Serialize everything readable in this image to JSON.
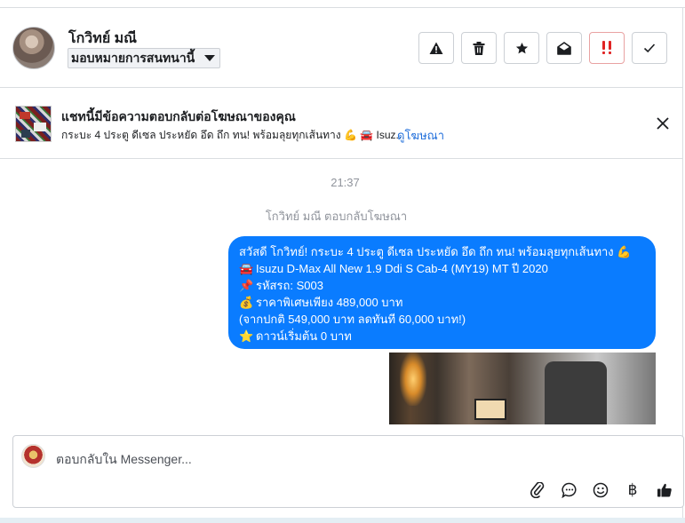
{
  "header": {
    "contact_name": "โกวิทย์ มณี",
    "assign_label": "มอบหมายการสนทนานี้",
    "actions": [
      {
        "name": "report-spam-button",
        "icon": "warning-icon"
      },
      {
        "name": "delete-button",
        "icon": "trash-icon"
      },
      {
        "name": "star-button",
        "icon": "star-icon"
      },
      {
        "name": "mark-unread-button",
        "icon": "envelope-open-icon"
      },
      {
        "name": "follow-up-button",
        "icon": "exclamation-icon"
      },
      {
        "name": "mark-done-button",
        "icon": "check-icon"
      }
    ]
  },
  "banner": {
    "title": "แชทนี้มีข้อความตอบกลับต่อโฆษณาของคุณ",
    "subtitle": "กระบะ 4 ประตู ดีเซล ประหยัด อึด ถึก ทน! พร้อมลุยทุกเส้นทาง 💪 🚘 Isuz...",
    "link": "ดูโฆษณา"
  },
  "thread": {
    "time": "21:37",
    "note": "โกวิทย์ มณี ตอบกลับโฆษณา",
    "message_lines": [
      {
        "emoji": "",
        "text": "สวัสดี โกวิทย์! กระบะ 4 ประตู ดีเซล ประหยัด อึด ถึก ทน! พร้อมลุยทุกเส้นทาง 💪"
      },
      {
        "emoji": "🚘",
        "text": "Isuzu D-Max All New 1.9 Ddi S Cab-4 (MY19) MT ปี 2020"
      },
      {
        "emoji": "📌",
        "text": "รหัสรถ: S003"
      },
      {
        "emoji": "💰",
        "text": "ราคาพิเศษเพียง 489,000 บาท"
      },
      {
        "emoji": "",
        "text": "(จากปกติ 549,000 บาท ลดทันที 60,000 บาท!)"
      },
      {
        "emoji": "⭐",
        "text": "ดาวน์เริ่มต้น 0 บาท"
      }
    ]
  },
  "composer": {
    "placeholder": "ตอบกลับใน Messenger...",
    "tools": [
      "paperclip-icon",
      "chat-bubble-icon",
      "emoji-icon",
      "baht-icon",
      "thumbs-up-icon"
    ],
    "baht_symbol": "฿"
  },
  "colors": {
    "bubble": "#0a7cff",
    "link": "#216fdb",
    "follow_up": "#e02424"
  }
}
